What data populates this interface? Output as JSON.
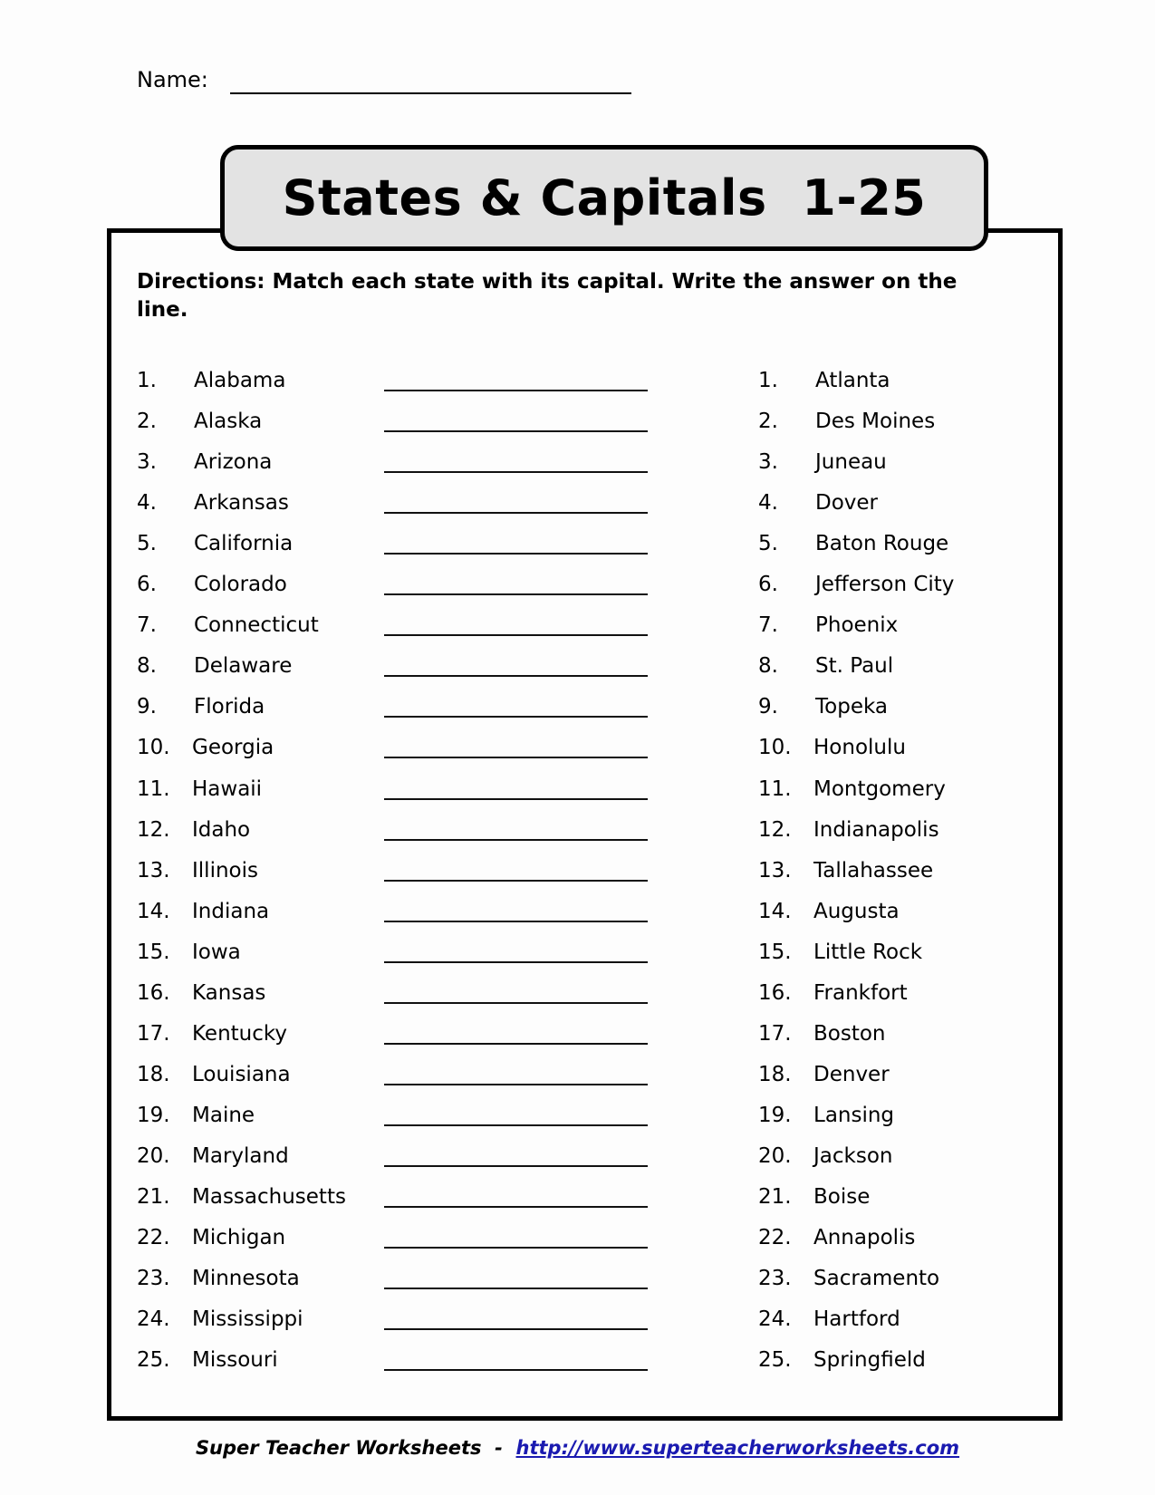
{
  "header": {
    "name_label": "Name:"
  },
  "title": "States & Capitals  1-25",
  "directions": "Directions:  Match each state with its capital.  Write the answer on the line.",
  "states": [
    {
      "num": "1.",
      "name": "Alabama"
    },
    {
      "num": "2.",
      "name": "Alaska"
    },
    {
      "num": "3.",
      "name": "Arizona"
    },
    {
      "num": "4.",
      "name": "Arkansas"
    },
    {
      "num": "5.",
      "name": "California"
    },
    {
      "num": "6.",
      "name": "Colorado"
    },
    {
      "num": "7.",
      "name": "Connecticut"
    },
    {
      "num": "8.",
      "name": "Delaware"
    },
    {
      "num": "9.",
      "name": "Florida"
    },
    {
      "num": "10.",
      "name": "Georgia"
    },
    {
      "num": "11.",
      "name": "Hawaii"
    },
    {
      "num": "12.",
      "name": "Idaho"
    },
    {
      "num": "13.",
      "name": "Illinois"
    },
    {
      "num": "14.",
      "name": "Indiana"
    },
    {
      "num": "15.",
      "name": "Iowa"
    },
    {
      "num": "16.",
      "name": "Kansas"
    },
    {
      "num": "17.",
      "name": "Kentucky"
    },
    {
      "num": "18.",
      "name": "Louisiana"
    },
    {
      "num": "19.",
      "name": "Maine"
    },
    {
      "num": "20.",
      "name": "Maryland"
    },
    {
      "num": "21.",
      "name": "Massachusetts"
    },
    {
      "num": "22.",
      "name": "Michigan"
    },
    {
      "num": "23.",
      "name": "Minnesota"
    },
    {
      "num": "24.",
      "name": "Mississippi"
    },
    {
      "num": "25.",
      "name": "Missouri"
    }
  ],
  "capitals": [
    {
      "num": "1.",
      "name": "Atlanta"
    },
    {
      "num": "2.",
      "name": "Des Moines"
    },
    {
      "num": "3.",
      "name": "Juneau"
    },
    {
      "num": "4.",
      "name": "Dover"
    },
    {
      "num": "5.",
      "name": "Baton Rouge"
    },
    {
      "num": "6.",
      "name": "Jefferson City"
    },
    {
      "num": "7.",
      "name": "Phoenix"
    },
    {
      "num": "8.",
      "name": "St. Paul"
    },
    {
      "num": "9.",
      "name": "Topeka"
    },
    {
      "num": "10.",
      "name": "Honolulu"
    },
    {
      "num": "11.",
      "name": "Montgomery"
    },
    {
      "num": "12.",
      "name": "Indianapolis"
    },
    {
      "num": "13.",
      "name": "Tallahassee"
    },
    {
      "num": "14.",
      "name": "Augusta"
    },
    {
      "num": "15.",
      "name": "Little Rock"
    },
    {
      "num": "16.",
      "name": "Frankfort"
    },
    {
      "num": "17.",
      "name": "Boston"
    },
    {
      "num": "18.",
      "name": "Denver"
    },
    {
      "num": "19.",
      "name": "Lansing"
    },
    {
      "num": "20.",
      "name": "Jackson"
    },
    {
      "num": "21.",
      "name": "Boise"
    },
    {
      "num": "22.",
      "name": "Annapolis"
    },
    {
      "num": "23.",
      "name": "Sacramento"
    },
    {
      "num": "24.",
      "name": "Hartford"
    },
    {
      "num": "25.",
      "name": "Springfield"
    }
  ],
  "footer": {
    "brand": "Super Teacher Worksheets",
    "separator": "  -  ",
    "link_text": "http://www.superteacherworksheets.com"
  }
}
